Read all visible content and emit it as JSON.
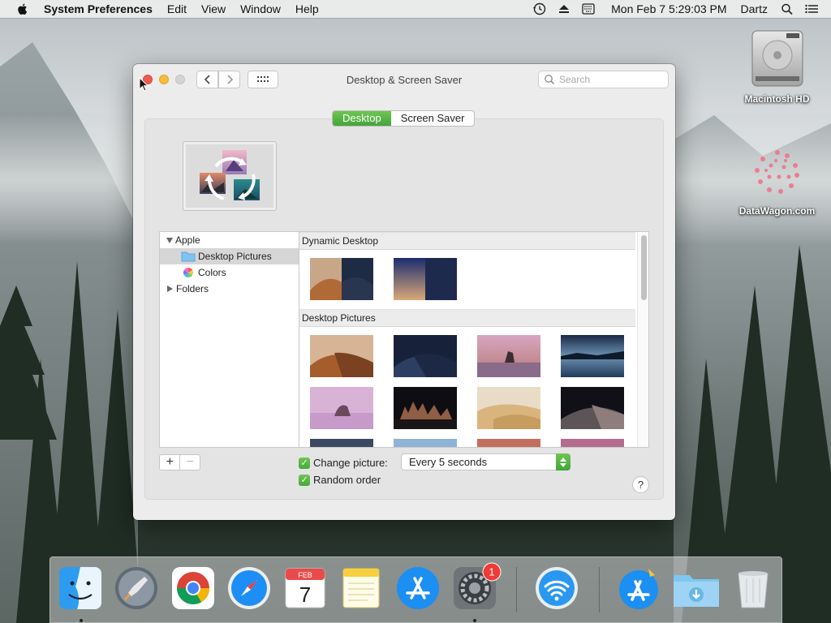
{
  "menubar": {
    "app_name": "System Preferences",
    "menus": [
      "Edit",
      "View",
      "Window",
      "Help"
    ],
    "status_icons": [
      "time-machine-icon",
      "eject-icon",
      "keyboard-viewer-icon"
    ],
    "clock": "Mon Feb 7  5:29:03 PM",
    "user": "Dartz",
    "spotlight_icon": "magnifier-icon",
    "notification_icon": "list-icon"
  },
  "desktop": {
    "icons": [
      {
        "label": "Macintosh HD",
        "icon": "hard-drive-icon"
      },
      {
        "label": "DataWagon.com",
        "icon": "flower-image-icon"
      }
    ]
  },
  "window": {
    "title": "Desktop & Screen Saver",
    "search_placeholder": "Search",
    "tabs": [
      {
        "label": "Desktop",
        "selected": true
      },
      {
        "label": "Screen Saver",
        "selected": false
      }
    ],
    "sidebar": {
      "items": [
        {
          "label": "Apple",
          "level": 0,
          "expanded": true
        },
        {
          "label": "Desktop Pictures",
          "level": 1,
          "selected": true,
          "icon": "folder-icon"
        },
        {
          "label": "Colors",
          "level": 1,
          "icon": "color-wheel-icon"
        },
        {
          "label": "Folders",
          "level": 0,
          "expanded": false
        }
      ]
    },
    "gallery": {
      "sections": [
        {
          "title": "Dynamic Desktop"
        },
        {
          "title": "Desktop Pictures"
        }
      ]
    },
    "add_label": "+",
    "remove_label": "−",
    "change_picture": {
      "label": "Change picture:",
      "checked": true
    },
    "random_order": {
      "label": "Random order",
      "checked": true
    },
    "interval": {
      "value": "Every 5 seconds"
    },
    "help_label": "?"
  },
  "dock": {
    "apps": [
      "Finder",
      "Launchpad",
      "Chrome",
      "Safari",
      "Calendar",
      "Notes",
      "App Store",
      "System Preferences",
      "Wireless Diagnostics",
      "App Store Downloads",
      "Downloads",
      "Trash"
    ],
    "calendar": {
      "month": "FEB",
      "day": "7"
    },
    "system_preferences_badge": "1"
  },
  "colors": {
    "accent_green": "#4caf3e",
    "close": "#ee5a52",
    "minimize": "#f5bd3a"
  }
}
